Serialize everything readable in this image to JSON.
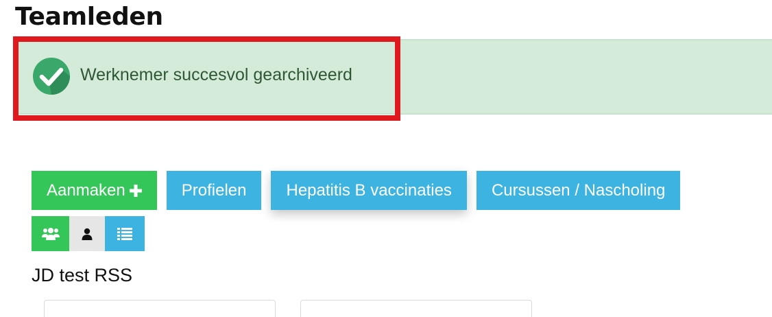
{
  "page": {
    "title": "Teamleden"
  },
  "alert": {
    "message": "Werknemer succesvol gearchiveerd",
    "icon": "check-circle-icon",
    "background_color": "#d5ebda",
    "highlight_color": "#e0191f"
  },
  "toolbar": {
    "create_label": "Aanmaken",
    "profiles_label": "Profielen",
    "hepatitis_label": "Hepatitis B vaccinaties",
    "courses_label": "Cursussen / Nascholing",
    "green_color": "#35c65a",
    "blue_color": "#3cb3e0"
  },
  "view_toggle": {
    "icons": [
      "users-group-icon",
      "user-icon",
      "list-icon"
    ]
  },
  "section": {
    "title": "JD test RSS"
  }
}
